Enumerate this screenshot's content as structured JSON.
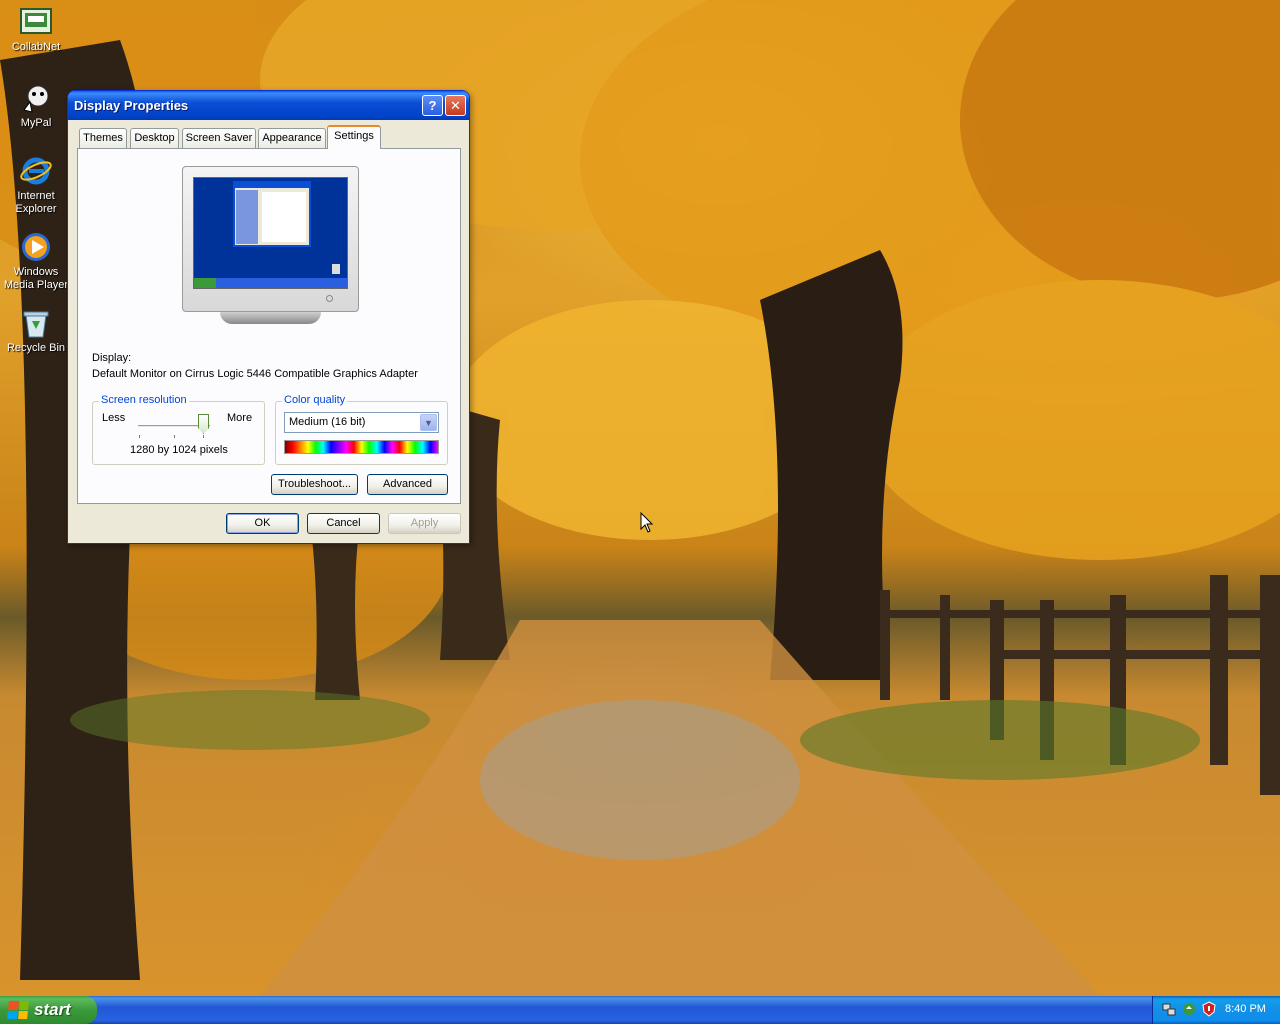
{
  "desktop": {
    "icons": [
      {
        "label": "CollabNet",
        "icon": "collabnet-icon"
      },
      {
        "label": "MyPal",
        "icon": "mypal-icon"
      },
      {
        "label": "Internet Explorer",
        "icon": "internet-explorer-icon"
      },
      {
        "label": "Windows Media Player",
        "icon": "media-player-icon"
      },
      {
        "label": "Recycle Bin",
        "icon": "recycle-bin-icon"
      }
    ]
  },
  "dialog": {
    "title": "Display Properties",
    "help_glyph": "?",
    "close_glyph": "✕",
    "tabs": [
      {
        "label": "Themes",
        "active": false
      },
      {
        "label": "Desktop",
        "active": false
      },
      {
        "label": "Screen Saver",
        "active": false
      },
      {
        "label": "Appearance",
        "active": false
      },
      {
        "label": "Settings",
        "active": true
      }
    ],
    "display_label": "Display:",
    "display_value": "Default Monitor on Cirrus Logic 5446 Compatible Graphics Adapter",
    "resolution": {
      "group_label": "Screen resolution",
      "less_label": "Less",
      "more_label": "More",
      "value_text": "1280 by 1024 pixels",
      "slider_level": 1.0
    },
    "color_quality": {
      "group_label": "Color quality",
      "selected": "Medium (16 bit)"
    },
    "buttons": {
      "troubleshoot": "Troubleshoot...",
      "advanced": "Advanced",
      "ok": "OK",
      "cancel": "Cancel",
      "apply": "Apply"
    }
  },
  "taskbar": {
    "start_label": "start",
    "clock": "8:40 PM",
    "tray_icons": [
      "network-icon",
      "update-icon",
      "security-shield-icon"
    ]
  },
  "colors": {
    "title_bar": "#0a4fd6",
    "dialog_bg": "#ece9d8",
    "group_label": "#0046d5",
    "active_tab_accent": "#e68b2c",
    "taskbar": "#2157d7",
    "start_button": "#3a9a3a"
  }
}
